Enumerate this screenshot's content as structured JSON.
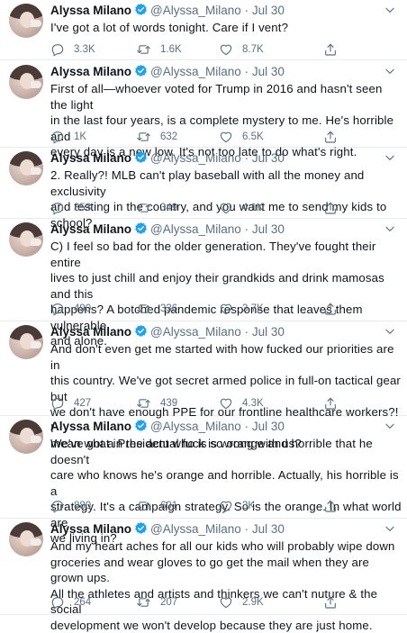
{
  "user": {
    "name": "Alyssa Milano",
    "handle": "@Alyssa_Milano",
    "separator": "·"
  },
  "tweets": [
    {
      "date": "Jul 30",
      "text": "I've got a lot of words tonight. Care if I vent?",
      "replies": "3.3K",
      "retweets": "1.6K",
      "likes": "8.7K"
    },
    {
      "date": "Jul 30",
      "text": "First of all—whoever voted for Trump in 2016 and hasn't seen the light\nin the last four years, is a complete mystery to me. He's horrible and\nevery day is a new low. It's not too late to do what's right.",
      "replies": "1K",
      "retweets": "632",
      "likes": "6.5K"
    },
    {
      "date": "Jul 30",
      "text": "2. Really?! MLB can't play baseball with all the money and exclusivity\nand testing in the country, and you want me to send my kids to school?",
      "replies": "353",
      "retweets": "349",
      "likes": "4.1K"
    },
    {
      "date": "Jul 30",
      "text": "C) I feel so bad for the older generation. They've fought their entire\nlives to just chill and enjoy their grandkids and drink mamosas and this\nhappens? A botched pandemic response that leaves them vulnerable\nand alone.",
      "replies": "490",
      "retweets": "336",
      "likes": "3.7K"
    },
    {
      "date": "Jul 30",
      "text": "And don't even get me started  with how fucked our priorities are in\nthis country. We've got secret armed police in full-on tactical gear but\nwe don't have enough PPE for our frontline healthcare workers?! I\nmean what in the actual fuck is wrong with us?",
      "replies": "427",
      "retweets": "439",
      "likes": "4.3K"
    },
    {
      "date": "Jul 30",
      "text": "We've got a President who is so orange and horrible that he doesn't\ncare who knows he's orange and horrible. Actually, his horrible is a\nstrategy. It's a campaign strategy. So is the orange. In what world are\nwe living in?",
      "replies": "880",
      "retweets": "601",
      "likes": "3K"
    },
    {
      "date": "Jul 30",
      "text": "And my heart aches for all our kids who will probably wipe down\ngroceries and wear gloves to go get the mail when they are grown ups.\nAll the athletes and artists and thinkers we can't nuture & the social\ndevelopment we won't develop because they are just home.",
      "replies": "264",
      "retweets": "207",
      "likes": "2.9K"
    }
  ],
  "colors": {
    "text": "#0f1419",
    "muted": "#5b7083",
    "verified": "#1da1f2",
    "divider": "#e6ecf0"
  },
  "icons": {
    "reply": "reply-icon",
    "retweet": "retweet-icon",
    "like": "heart-icon",
    "share": "share-icon",
    "more": "chevron-down-icon",
    "verified": "verified-badge-icon"
  }
}
